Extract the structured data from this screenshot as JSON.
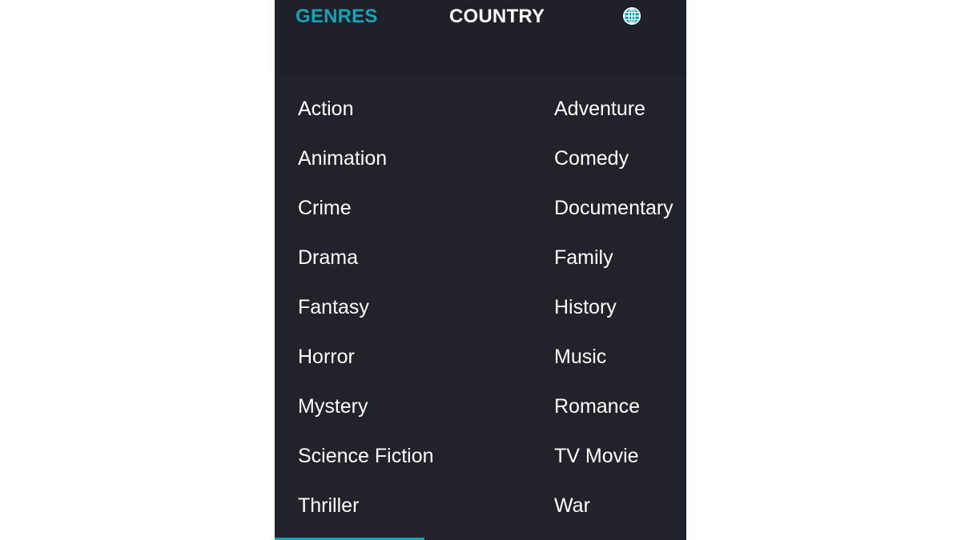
{
  "tabs": {
    "genres_label": "GENRES",
    "country_label": "COUNTRY"
  },
  "icons": {
    "language": "globe-icon"
  },
  "colors": {
    "accent": "#17a2b8",
    "panel_bg": "#22222b",
    "text": "#ffffff"
  },
  "genres": {
    "left": [
      "Action",
      "Animation",
      "Crime",
      "Drama",
      "Fantasy",
      "Horror",
      "Mystery",
      "Science Fiction",
      "Thriller"
    ],
    "right": [
      "Adventure",
      "Comedy",
      "Documentary",
      "Family",
      "History",
      "Music",
      "Romance",
      "TV Movie",
      "War"
    ]
  }
}
